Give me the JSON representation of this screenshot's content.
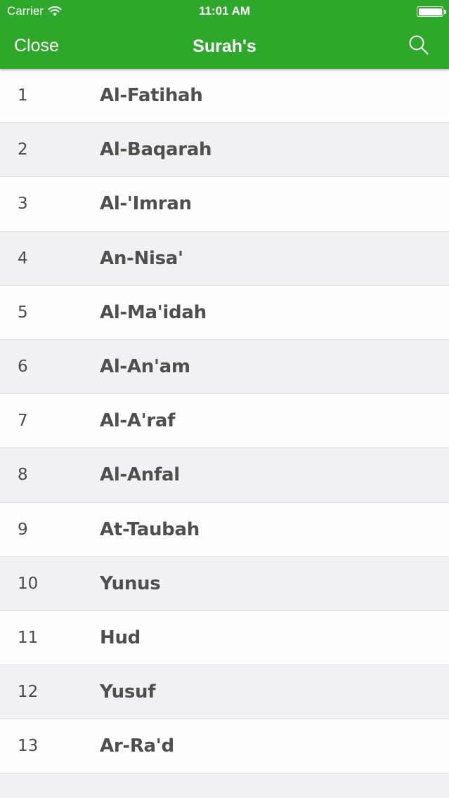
{
  "status_bar": {
    "carrier": "Carrier",
    "time": "11:01 AM",
    "icons": [
      "wifi-icon",
      "battery-icon"
    ]
  },
  "nav": {
    "close_label": "Close",
    "title": "Surah's",
    "search_icon": "search-icon"
  },
  "colors": {
    "header_green": "#2ea82a",
    "row_odd": "#fdfdfd",
    "row_even": "#f1f0f2",
    "text": "#4f4f4f"
  },
  "surahs": [
    {
      "number": "1",
      "name": "Al-Fatihah"
    },
    {
      "number": "2",
      "name": "Al-Baqarah"
    },
    {
      "number": "3",
      "name": "Al-'Imran"
    },
    {
      "number": "4",
      "name": "An-Nisa'"
    },
    {
      "number": "5",
      "name": "Al-Ma'idah"
    },
    {
      "number": "6",
      "name": "Al-An'am"
    },
    {
      "number": "7",
      "name": "Al-A'raf"
    },
    {
      "number": "8",
      "name": "Al-Anfal"
    },
    {
      "number": "9",
      "name": "At-Taubah"
    },
    {
      "number": "10",
      "name": "Yunus"
    },
    {
      "number": "11",
      "name": "Hud"
    },
    {
      "number": "12",
      "name": "Yusuf"
    },
    {
      "number": "13",
      "name": "Ar-Ra'd"
    },
    {
      "number": "",
      "name": ""
    }
  ]
}
